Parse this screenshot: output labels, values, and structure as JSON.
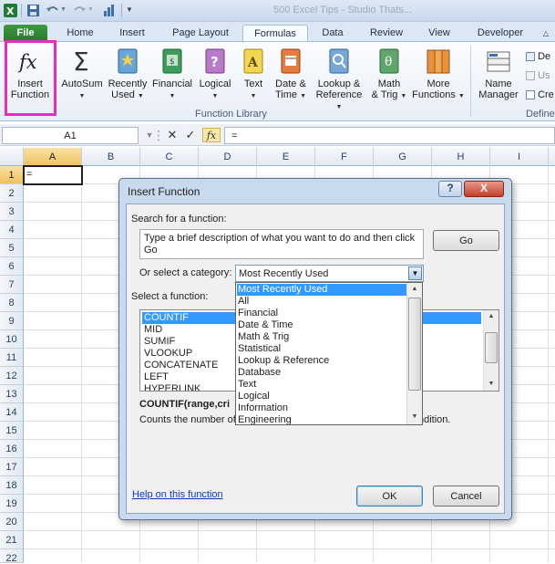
{
  "window": {
    "title": "500 Excel Tips - Studio Thats..."
  },
  "tabs": [
    {
      "label": "File"
    },
    {
      "label": "Home"
    },
    {
      "label": "Insert"
    },
    {
      "label": "Page Layout"
    },
    {
      "label": "Formulas"
    },
    {
      "label": "Data"
    },
    {
      "label": "Review"
    },
    {
      "label": "View"
    },
    {
      "label": "Developer"
    }
  ],
  "ribbon": {
    "insert_function": {
      "line1": "Insert",
      "line2": "Function"
    },
    "autosum": {
      "line1": "AutoSum"
    },
    "recently_used": {
      "line1": "Recently",
      "line2": "Used"
    },
    "financial": {
      "line1": "Financial"
    },
    "logical": {
      "line1": "Logical"
    },
    "text": {
      "line1": "Text"
    },
    "date_time": {
      "line1": "Date &",
      "line2": "Time"
    },
    "lookup": {
      "line1": "Lookup &",
      "line2": "Reference"
    },
    "math": {
      "line1": "Math",
      "line2": "& Trig"
    },
    "more": {
      "line1": "More",
      "line2": "Functions"
    },
    "group_function_library": "Function Library",
    "name_manager": {
      "line1": "Name",
      "line2": "Manager"
    },
    "define_name": "De",
    "use_in_formula": "Us",
    "create_from_selection": "Cre",
    "group_defined": "Define"
  },
  "formula_bar": {
    "name_box": "A1",
    "fx": "fx",
    "value": "="
  },
  "columns": [
    "A",
    "B",
    "C",
    "D",
    "E",
    "F",
    "G",
    "H",
    "I"
  ],
  "rows": [
    "1",
    "2",
    "3",
    "4",
    "5",
    "6",
    "7",
    "8",
    "9",
    "10",
    "11",
    "12",
    "13",
    "14",
    "15",
    "16",
    "17",
    "18",
    "19",
    "20",
    "21",
    "22"
  ],
  "cell_a1": "=",
  "dialog": {
    "title": "Insert Function",
    "help_btn": "?",
    "close_btn": "X",
    "search_label": "Search for a function:",
    "search_value": "Type a brief description of what you want to do and then click Go",
    "go_label": "Go",
    "category_label": "Or select a category:",
    "category_value": "Most Recently Used",
    "select_label": "Select a function:",
    "functions": [
      "COUNTIF",
      "MID",
      "SUMIF",
      "VLOOKUP",
      "CONCATENATE",
      "LEFT",
      "HYPERLINK"
    ],
    "syntax": "COUNTIF(range,cri",
    "description_start": "Counts the number of",
    "description_end": "ndition.",
    "help_link": "Help on this function",
    "ok_label": "OK",
    "cancel_label": "Cancel",
    "categories": [
      "Most Recently Used",
      "All",
      "Financial",
      "Date & Time",
      "Math & Trig",
      "Statistical",
      "Lookup & Reference",
      "Database",
      "Text",
      "Logical",
      "Information",
      "Engineering"
    ]
  },
  "colors": {
    "file_tab": "#2d8a32",
    "highlight": "#e52dbf",
    "selection": "#3399ff"
  }
}
